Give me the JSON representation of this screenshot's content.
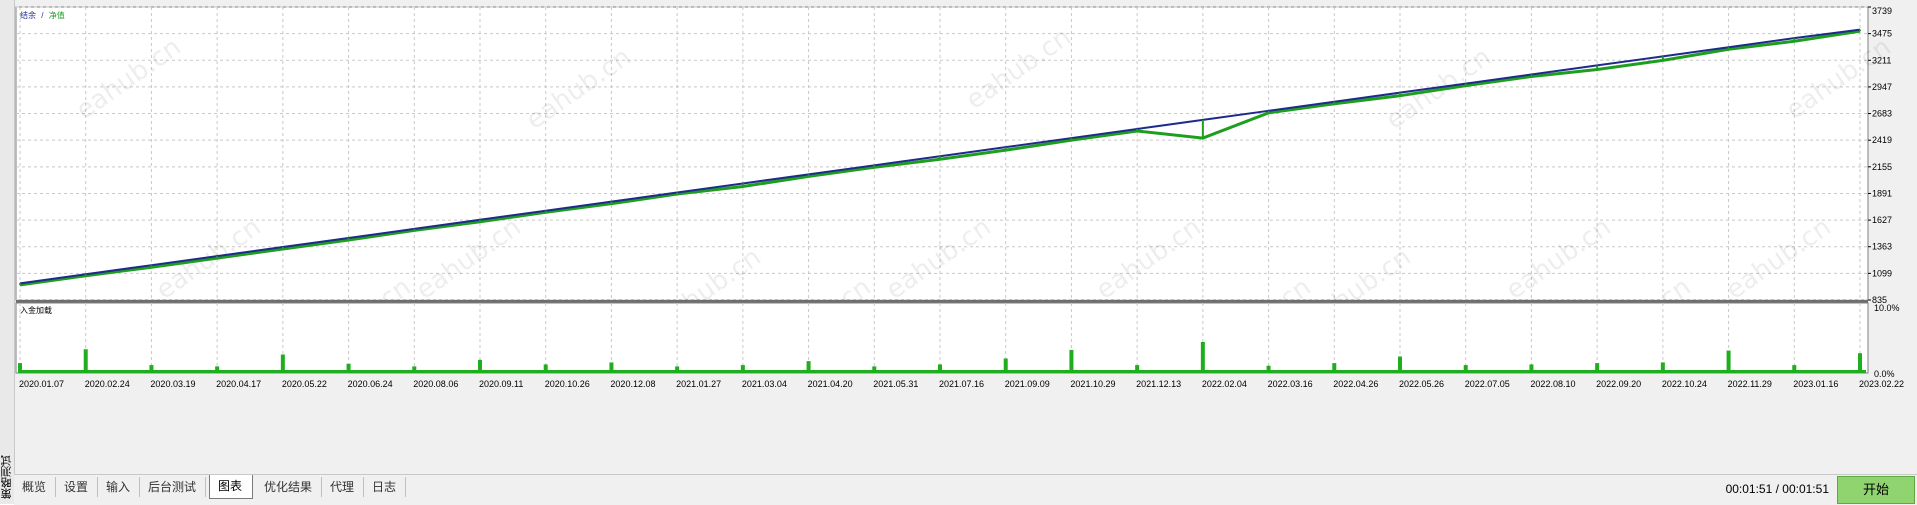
{
  "side_panel": {
    "title": "策略测试"
  },
  "main_chart": {
    "legend": [
      {
        "label": "结余",
        "color": "#1e2a8c"
      },
      {
        "label": "/",
        "color": "#1e2a8c"
      },
      {
        "label": "净值",
        "color": "#1e9e1e"
      }
    ],
    "y_ticks": [
      "3739",
      "3475",
      "3211",
      "2947",
      "2683",
      "2419",
      "2155",
      "1891",
      "1627",
      "1363",
      "1099",
      "835"
    ]
  },
  "load_chart": {
    "label": "入金加载",
    "y_ticks": [
      "10.0%",
      "0.0%"
    ]
  },
  "x_ticks": [
    "2020.01.07",
    "2020.02.24",
    "2020.03.19",
    "2020.04.17",
    "2020.05.22",
    "2020.06.24",
    "2020.08.06",
    "2020.09.11",
    "2020.10.26",
    "2020.12.08",
    "2021.01.27",
    "2021.03.04",
    "2021.04.20",
    "2021.05.31",
    "2021.07.16",
    "2021.09.09",
    "2021.10.29",
    "2021.12.13",
    "2022.02.04",
    "2022.03.16",
    "2022.04.26",
    "2022.05.26",
    "2022.07.05",
    "2022.08.10",
    "2022.09.20",
    "2022.10.24",
    "2022.11.29",
    "2023.01.16",
    "2023.02.22"
  ],
  "watermark": "eahub.cn",
  "chart_data": {
    "type": "line",
    "x": [
      "2020.01.07",
      "2020.02.24",
      "2020.03.19",
      "2020.04.17",
      "2020.05.22",
      "2020.06.24",
      "2020.08.06",
      "2020.09.11",
      "2020.10.26",
      "2020.12.08",
      "2021.01.27",
      "2021.03.04",
      "2021.04.20",
      "2021.05.31",
      "2021.07.16",
      "2021.09.09",
      "2021.10.29",
      "2021.12.13",
      "2022.02.04",
      "2022.03.16",
      "2022.04.26",
      "2022.05.26",
      "2022.07.05",
      "2022.08.10",
      "2022.09.20",
      "2022.10.24",
      "2022.11.29",
      "2023.01.16",
      "2023.02.22"
    ],
    "series": [
      {
        "name": "结余",
        "color": "#1e2a8c",
        "values": [
          1000,
          1090,
          1180,
          1270,
          1360,
          1450,
          1540,
          1630,
          1720,
          1810,
          1900,
          1990,
          2080,
          2170,
          2260,
          2350,
          2440,
          2530,
          2620,
          2710,
          2800,
          2890,
          2980,
          3070,
          3160,
          3250,
          3340,
          3430,
          3515
        ]
      },
      {
        "name": "净值",
        "color": "#1e9e1e",
        "values": [
          985,
          1075,
          1160,
          1250,
          1340,
          1430,
          1525,
          1610,
          1705,
          1790,
          1885,
          1960,
          2060,
          2150,
          2230,
          2320,
          2420,
          2510,
          2440,
          2690,
          2780,
          2860,
          2960,
          3050,
          3120,
          3210,
          3320,
          3400,
          3500
        ]
      }
    ],
    "ylim": [
      835,
      3739
    ],
    "load": {
      "ylim": [
        0,
        10
      ],
      "values": [
        1.5,
        3.6,
        1.2,
        1.0,
        2.8,
        1.4,
        1.0,
        2.0,
        1.3,
        1.6,
        1.0,
        1.2,
        1.8,
        1.0,
        1.3,
        2.2,
        3.5,
        1.2,
        4.7,
        1.1,
        1.5,
        2.5,
        1.2,
        1.3,
        1.5,
        1.6,
        3.4,
        1.2,
        3.0
      ]
    }
  }
}
